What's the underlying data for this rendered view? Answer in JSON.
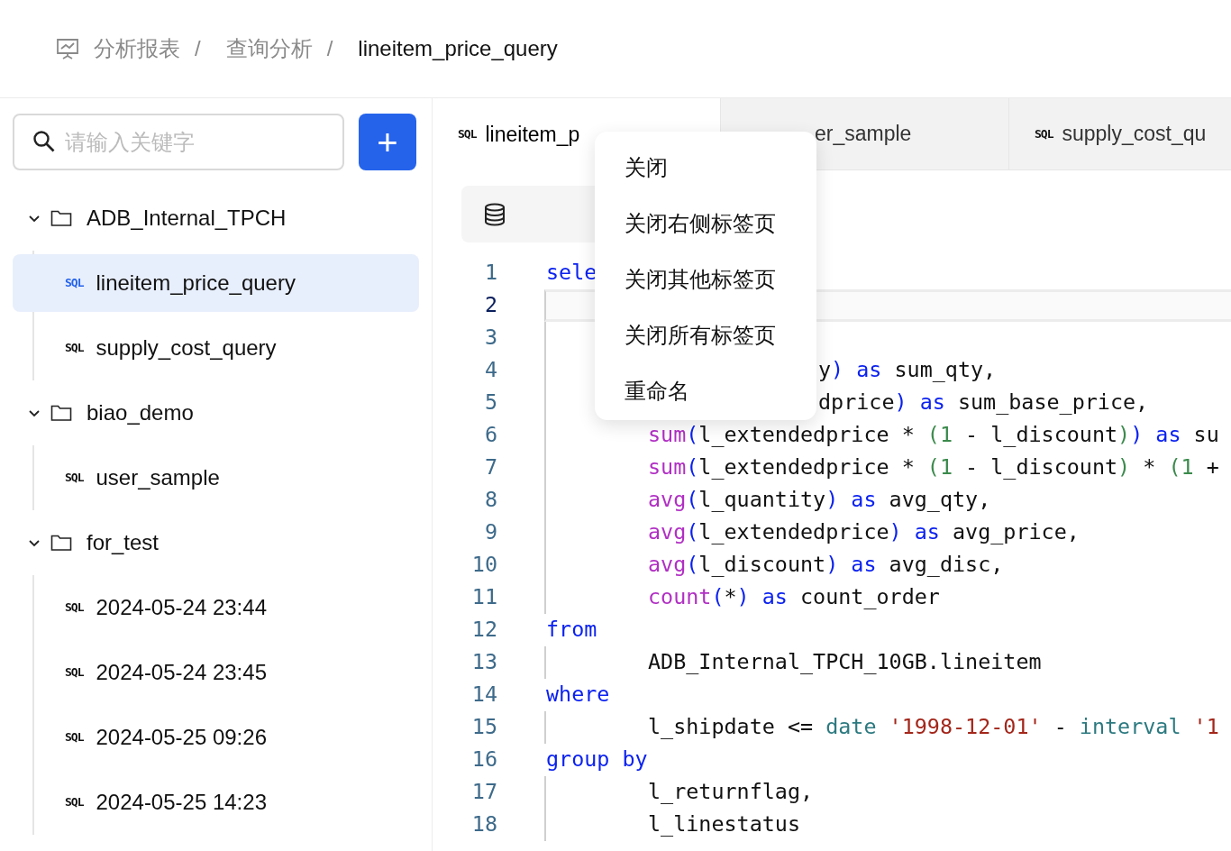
{
  "breadcrumb": [
    {
      "label": "分析报表",
      "current": false
    },
    {
      "label": "查询分析",
      "current": false
    },
    {
      "label": "lineitem_price_query",
      "current": true
    }
  ],
  "breadcrumb_separator": "/",
  "sidebar": {
    "search": {
      "placeholder": "请输入关键字"
    },
    "add_button": "+",
    "tree": [
      {
        "label": "ADB_Internal_TPCH",
        "expanded": true,
        "children": [
          {
            "badge": "SQL",
            "label": "lineitem_price_query",
            "selected": true
          },
          {
            "badge": "SQL",
            "label": "supply_cost_query",
            "selected": false
          }
        ]
      },
      {
        "label": "biao_demo",
        "expanded": true,
        "children": [
          {
            "badge": "SQL",
            "label": "user_sample",
            "selected": false
          }
        ]
      },
      {
        "label": "for_test",
        "expanded": true,
        "children": [
          {
            "badge": "SQL",
            "label": "2024-05-24 23:44",
            "selected": false
          },
          {
            "badge": "SQL",
            "label": "2024-05-24 23:45",
            "selected": false
          },
          {
            "badge": "SQL",
            "label": "2024-05-25 09:26",
            "selected": false
          },
          {
            "badge": "SQL",
            "label": "2024-05-25 14:23",
            "selected": false
          }
        ]
      }
    ]
  },
  "tabs": [
    {
      "badge": "SQL",
      "label": "lineitem_p",
      "selected": true,
      "partial": false
    },
    {
      "label": "er_sample",
      "selected": false,
      "partial": true
    },
    {
      "badge": "SQL",
      "label": "supply_cost_qu",
      "selected": false,
      "partial": false
    }
  ],
  "context_menu": [
    "关闭",
    "关闭右侧标签页",
    "关闭其他标签页",
    "关闭所有标签页",
    "重命名"
  ],
  "editor": {
    "lines": [
      {
        "number": "1",
        "current": false,
        "guide": false,
        "indent": false,
        "partial": false,
        "tokens": [
          {
            "kind": "kw",
            "text": "sele"
          }
        ]
      },
      {
        "number": "2",
        "current": true,
        "guide": true,
        "indent": false,
        "partial": false
      },
      {
        "number": "3",
        "current": false,
        "guide": true,
        "indent": false,
        "partial": false
      },
      {
        "number": "4",
        "current": false,
        "guide": true,
        "partial": true,
        "tokens": [
          {
            "kind": "plain",
            "text": "y"
          },
          {
            "kind": "paren1",
            "text": ")"
          },
          {
            "kind": "kw",
            "text": " as"
          },
          {
            "kind": "plain",
            "text": " sum_qty,"
          }
        ]
      },
      {
        "number": "5",
        "current": false,
        "guide": true,
        "partial": true,
        "tokens": [
          {
            "kind": "plain",
            "text": "dprice"
          },
          {
            "kind": "paren1",
            "text": ")"
          },
          {
            "kind": "kw",
            "text": " as"
          },
          {
            "kind": "plain",
            "text": " sum_base_price,"
          }
        ]
      },
      {
        "number": "6",
        "current": false,
        "guide": true,
        "indent": true,
        "partial": false,
        "tokens": [
          {
            "kind": "fn",
            "text": "sum"
          },
          {
            "kind": "paren1",
            "text": "("
          },
          {
            "kind": "plain",
            "text": "l_extendedprice * "
          },
          {
            "kind": "paren2",
            "text": "("
          },
          {
            "kind": "num",
            "text": "1"
          },
          {
            "kind": "plain",
            "text": " - l_discount"
          },
          {
            "kind": "paren2",
            "text": ")"
          },
          {
            "kind": "paren1",
            "text": ")"
          },
          {
            "kind": "kw",
            "text": " as"
          },
          {
            "kind": "plain",
            "text": " su"
          }
        ]
      },
      {
        "number": "7",
        "current": false,
        "guide": true,
        "indent": true,
        "partial": false,
        "tokens": [
          {
            "kind": "fn",
            "text": "sum"
          },
          {
            "kind": "paren1",
            "text": "("
          },
          {
            "kind": "plain",
            "text": "l_extendedprice * "
          },
          {
            "kind": "paren2",
            "text": "("
          },
          {
            "kind": "num",
            "text": "1"
          },
          {
            "kind": "plain",
            "text": " - l_discount"
          },
          {
            "kind": "paren2",
            "text": ")"
          },
          {
            "kind": "plain",
            "text": " * "
          },
          {
            "kind": "paren2",
            "text": "("
          },
          {
            "kind": "num",
            "text": "1"
          },
          {
            "kind": "plain",
            "text": " +"
          }
        ]
      },
      {
        "number": "8",
        "current": false,
        "guide": true,
        "indent": true,
        "partial": false,
        "tokens": [
          {
            "kind": "fn",
            "text": "avg"
          },
          {
            "kind": "paren1",
            "text": "("
          },
          {
            "kind": "plain",
            "text": "l_quantity"
          },
          {
            "kind": "paren1",
            "text": ")"
          },
          {
            "kind": "kw",
            "text": " as"
          },
          {
            "kind": "plain",
            "text": " avg_qty,"
          }
        ]
      },
      {
        "number": "9",
        "current": false,
        "guide": true,
        "indent": true,
        "partial": false,
        "tokens": [
          {
            "kind": "fn",
            "text": "avg"
          },
          {
            "kind": "paren1",
            "text": "("
          },
          {
            "kind": "plain",
            "text": "l_extendedprice"
          },
          {
            "kind": "paren1",
            "text": ")"
          },
          {
            "kind": "kw",
            "text": " as"
          },
          {
            "kind": "plain",
            "text": " avg_price,"
          }
        ]
      },
      {
        "number": "10",
        "current": false,
        "guide": true,
        "indent": true,
        "partial": false,
        "tokens": [
          {
            "kind": "fn",
            "text": "avg"
          },
          {
            "kind": "paren1",
            "text": "("
          },
          {
            "kind": "plain",
            "text": "l_discount"
          },
          {
            "kind": "paren1",
            "text": ")"
          },
          {
            "kind": "kw",
            "text": " as"
          },
          {
            "kind": "plain",
            "text": " avg_disc,"
          }
        ]
      },
      {
        "number": "11",
        "current": false,
        "guide": true,
        "indent": true,
        "partial": false,
        "tokens": [
          {
            "kind": "fn",
            "text": "count"
          },
          {
            "kind": "paren1",
            "text": "("
          },
          {
            "kind": "plain",
            "text": "*"
          },
          {
            "kind": "paren1",
            "text": ")"
          },
          {
            "kind": "kw",
            "text": " as"
          },
          {
            "kind": "plain",
            "text": " count_order"
          }
        ]
      },
      {
        "number": "12",
        "current": false,
        "guide": false,
        "indent": false,
        "partial": false,
        "tokens": [
          {
            "kind": "kw",
            "text": "from"
          }
        ]
      },
      {
        "number": "13",
        "current": false,
        "guide": true,
        "indent": true,
        "partial": false,
        "tokens": [
          {
            "kind": "plain",
            "text": "ADB_Internal_TPCH_10GB.lineitem"
          }
        ]
      },
      {
        "number": "14",
        "current": false,
        "guide": false,
        "indent": false,
        "partial": false,
        "tokens": [
          {
            "kind": "kw",
            "text": "where"
          }
        ]
      },
      {
        "number": "15",
        "current": false,
        "guide": true,
        "indent": true,
        "partial": false,
        "tokens": [
          {
            "kind": "plain",
            "text": "l_shipdate <= "
          },
          {
            "kind": "type",
            "text": "date"
          },
          {
            "kind": "str",
            "text": " '1998-12-01'"
          },
          {
            "kind": "plain",
            "text": " - "
          },
          {
            "kind": "type",
            "text": "interval"
          },
          {
            "kind": "str",
            "text": " '1"
          }
        ]
      },
      {
        "number": "16",
        "current": false,
        "guide": false,
        "indent": false,
        "partial": false,
        "tokens": [
          {
            "kind": "kw",
            "text": "group by"
          }
        ]
      },
      {
        "number": "17",
        "current": false,
        "guide": true,
        "indent": true,
        "partial": false,
        "tokens": [
          {
            "kind": "plain",
            "text": "l_returnflag,"
          }
        ]
      },
      {
        "number": "18",
        "current": false,
        "guide": true,
        "indent": true,
        "partial": false,
        "tokens": [
          {
            "kind": "plain",
            "text": "l_linestatus"
          }
        ]
      }
    ]
  }
}
